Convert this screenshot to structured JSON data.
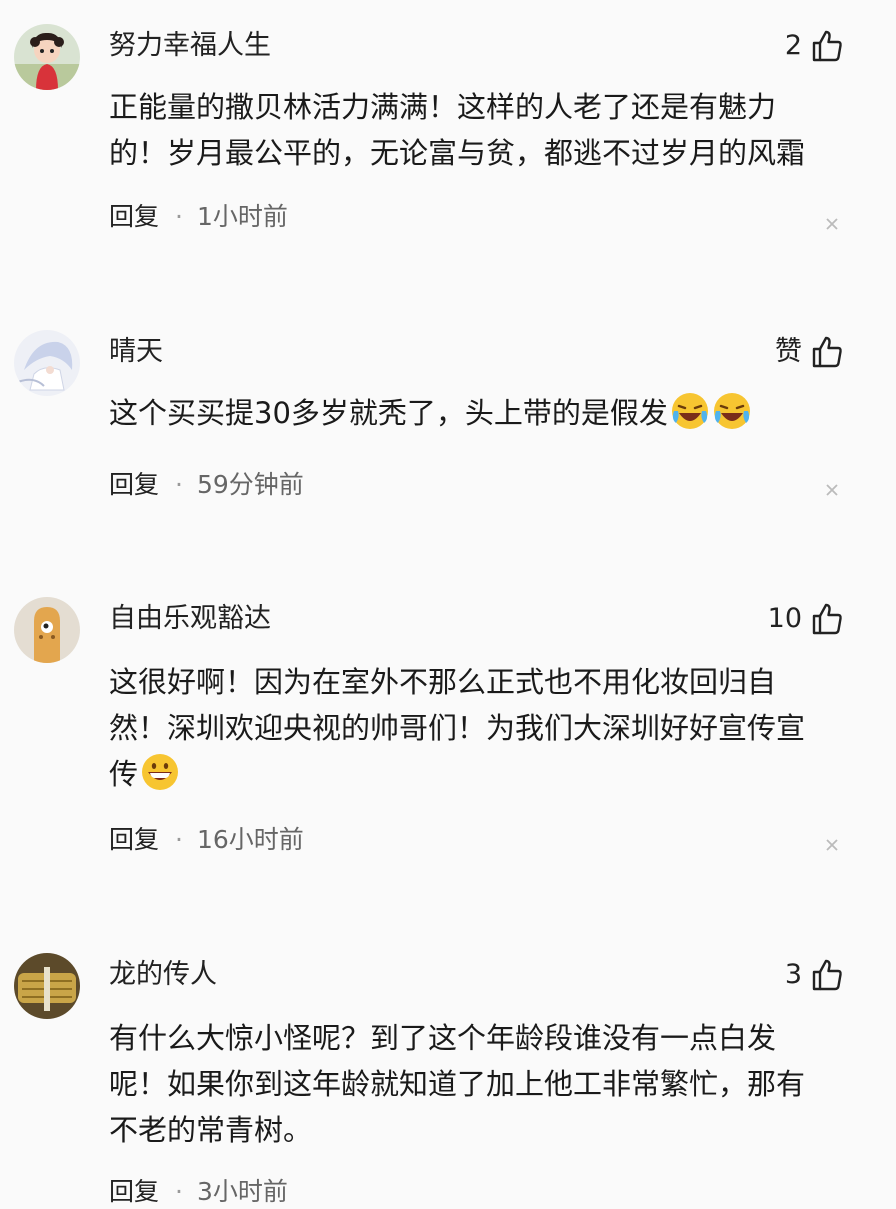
{
  "comments": [
    {
      "username": "努力幸福人生",
      "like_label": "2",
      "text_lines": [
        "正能量的撒贝林活力满满！这样的人老了还是有魅力",
        "的！岁月最公平的，无论富与贫，都逃不过岁月的风霜"
      ],
      "reply_label": "回复",
      "separator": "·",
      "time": "1小时前",
      "avatar_icon": "girl-avatar"
    },
    {
      "username": "晴天",
      "like_label": "赞",
      "text": "这个买买提30多岁就秃了，头上带的是假发",
      "emojis": [
        "laughing-crying-emoji",
        "laughing-crying-emoji"
      ],
      "reply_label": "回复",
      "separator": "·",
      "time": "59分钟前",
      "avatar_icon": "anime-avatar"
    },
    {
      "username": "自由乐观豁达",
      "like_label": "10",
      "text_lines": [
        "这很好啊！因为在室外不那么正式也不用化妆回归自",
        "然！深圳欢迎央视的帅哥们！为我们大深圳好好宣传宣",
        "传"
      ],
      "emojis": [
        "grinning-emoji"
      ],
      "reply_label": "回复",
      "separator": "·",
      "time": "16小时前",
      "avatar_icon": "cartoon-avatar"
    },
    {
      "username": "龙的传人",
      "like_label": "3",
      "text_lines": [
        "有什么大惊小怪呢？到了这个年龄段谁没有一点白发",
        "呢！如果你到这年龄就知道了加上他工非常繁忙，那有",
        "不老的常青树。"
      ],
      "reply_label": "回复",
      "separator": "·",
      "time": "3小时前",
      "avatar_icon": "photo-avatar"
    }
  ],
  "colors": {
    "background": "#fafafa",
    "text": "#1a1a1a",
    "meta": "#666666",
    "emoji_yellow": "#f7c531"
  }
}
